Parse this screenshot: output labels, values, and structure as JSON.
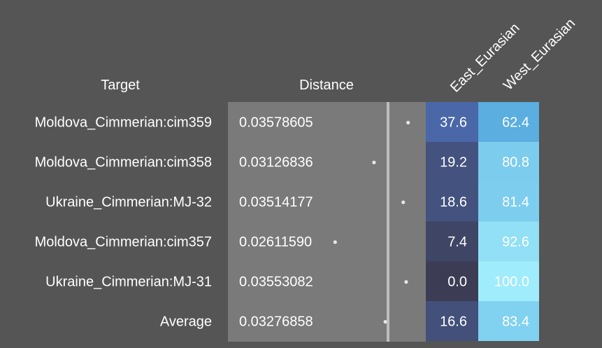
{
  "chart_data": {
    "type": "table",
    "columns": {
      "target": "Target",
      "distance": "Distance",
      "components": [
        "East_Eurasian",
        "West_Eurasian"
      ]
    },
    "rows": [
      {
        "target": "Moldova_Cimmerian:cim359",
        "distance": "0.03578605",
        "distance_value": 0.03578605,
        "values": [
          "37.6",
          "62.4"
        ]
      },
      {
        "target": "Moldova_Cimmerian:cim358",
        "distance": "0.03126836",
        "distance_value": 0.03126836,
        "values": [
          "19.2",
          "80.8"
        ]
      },
      {
        "target": "Ukraine_Cimmerian:MJ-32",
        "distance": "0.03514177",
        "distance_value": 0.03514177,
        "values": [
          "18.6",
          "81.4"
        ]
      },
      {
        "target": "Moldova_Cimmerian:cim357",
        "distance": "0.02611590",
        "distance_value": 0.0261159,
        "values": [
          "7.4",
          "92.6"
        ]
      },
      {
        "target": "Ukraine_Cimmerian:MJ-31",
        "distance": "0.03553082",
        "distance_value": 0.03553082,
        "values": [
          "0.0",
          "100.0"
        ]
      },
      {
        "target": "Average",
        "distance": "0.03276858",
        "distance_value": 0.03276858,
        "values": [
          "16.6",
          "83.4"
        ]
      }
    ],
    "colors": {
      "background": "#555555",
      "distance_panel": "#7a7a7a",
      "divider": "#bdbdbd",
      "dot": "#e6e6e6",
      "east_low": "#3c3d55",
      "east_high": "#4a67a8",
      "west_low": "#5aaee0",
      "west_high": "#9fecfc"
    }
  }
}
